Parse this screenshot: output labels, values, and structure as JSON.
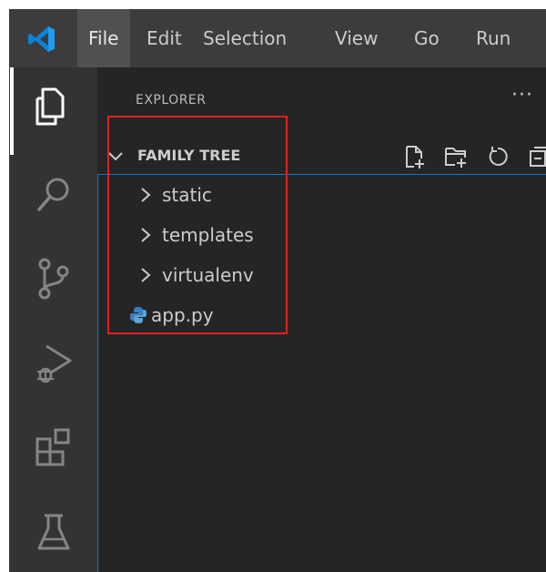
{
  "titlebar": {
    "menu": [
      {
        "label": "File"
      },
      {
        "label": "Edit"
      },
      {
        "label": "Selection"
      },
      {
        "label": "View"
      },
      {
        "label": "Go"
      },
      {
        "label": "Run"
      }
    ],
    "active_menu": "File"
  },
  "activity_bar": {
    "items": [
      {
        "name": "explorer",
        "icon": "files-icon",
        "active": true
      },
      {
        "name": "search",
        "icon": "search-icon"
      },
      {
        "name": "source-control",
        "icon": "source-control-icon"
      },
      {
        "name": "run-and-debug",
        "icon": "debug-icon"
      },
      {
        "name": "extensions",
        "icon": "extensions-icon"
      },
      {
        "name": "testing",
        "icon": "flask-icon"
      }
    ]
  },
  "sidebar": {
    "title": "EXPLORER",
    "more_actions": "···",
    "section": {
      "title": "FAMILY TREE",
      "expanded": true,
      "actions": [
        "new-file-icon",
        "new-folder-icon",
        "refresh-icon",
        "collapse-all-icon"
      ]
    },
    "tree": [
      {
        "label": "static",
        "type": "folder",
        "expanded": false
      },
      {
        "label": "templates",
        "type": "folder",
        "expanded": false
      },
      {
        "label": "virtualenv",
        "type": "folder",
        "expanded": false
      },
      {
        "label": "app.py",
        "type": "file",
        "icon": "python-file-icon"
      }
    ]
  },
  "colors": {
    "titlebar_bg": "#3c3c3c",
    "activity_bar_bg": "#333333",
    "sidebar_bg": "#252526",
    "focus_border": "#007fd4",
    "annotation_box": "#e02020",
    "vscode_blue": "#0a84d8"
  }
}
